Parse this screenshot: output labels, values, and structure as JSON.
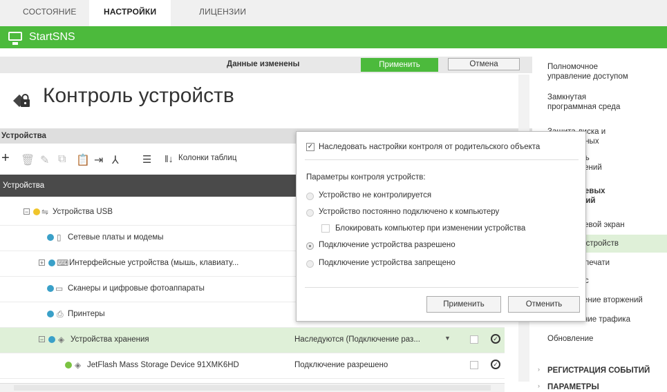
{
  "top_tabs": [
    "СОСТОЯНИЕ",
    "НАСТРОЙКИ",
    "ЛИЦЕНЗИИ"
  ],
  "app_title": "StartSNS",
  "changes_bar": {
    "message": "Данные изменены",
    "apply": "Применить",
    "cancel": "Отмена"
  },
  "page_title": "Контроль устройств",
  "devices_section": "Устройства",
  "toolbar": {
    "columns_label": "Колонки таблиц"
  },
  "table_header": "Устройства",
  "rows": [
    {
      "label": "Устройства USB",
      "value": ""
    },
    {
      "label": "Сетевые платы и модемы",
      "value": ""
    },
    {
      "label": "Интерфейсные устройства (мышь, клавиату...",
      "value": ""
    },
    {
      "label": "Сканеры и цифровые фотоаппараты",
      "value": ""
    },
    {
      "label": "Принтеры",
      "value": ""
    },
    {
      "label": "Устройства хранения",
      "value": "Наследуются (Подключение раз..."
    },
    {
      "label": "JetFlash Mass Storage Device 91XMK6HD",
      "value": "Подключение разрешено"
    }
  ],
  "popup": {
    "inherit": "Наследовать настройки контроля от родительского объекта",
    "params_title": "Параметры контроля устройств:",
    "opt_not_controlled": "Устройство не контролируется",
    "opt_always_connected": "Устройство постоянно подключено к компьютеру",
    "opt_lock": "Блокировать компьютер при изменении устройства",
    "opt_allowed": "Подключение устройства разрешено",
    "opt_denied": "Подключение устройства запрещено",
    "apply": "Применить",
    "cancel": "Отменить"
  },
  "right_panel": {
    "item1a": "Полномочное",
    "item1b": "управление доступом",
    "item2a": "Замкнутая",
    "item2b": "программная среда",
    "item3a": "Защита диска и",
    "item3b": "вание данных",
    "item4a": "ль",
    "item4b": "кений",
    "item5a": "етевых",
    "item5b": "ений",
    "item6": "тевой экран",
    "item7": "устройств",
    "item8": "печати",
    "item9": "с",
    "item10": "ение вторжений",
    "item11": "ние трафика",
    "item12": "Обновление",
    "section1": "РЕГИСТРАЦИЯ СОБЫТИЙ",
    "section2": "ПАРАМЕТРЫ"
  },
  "colors": {
    "accent": "#4cba3c",
    "header_dark": "#4a4a4a",
    "selected_row": "#dff0d8"
  }
}
